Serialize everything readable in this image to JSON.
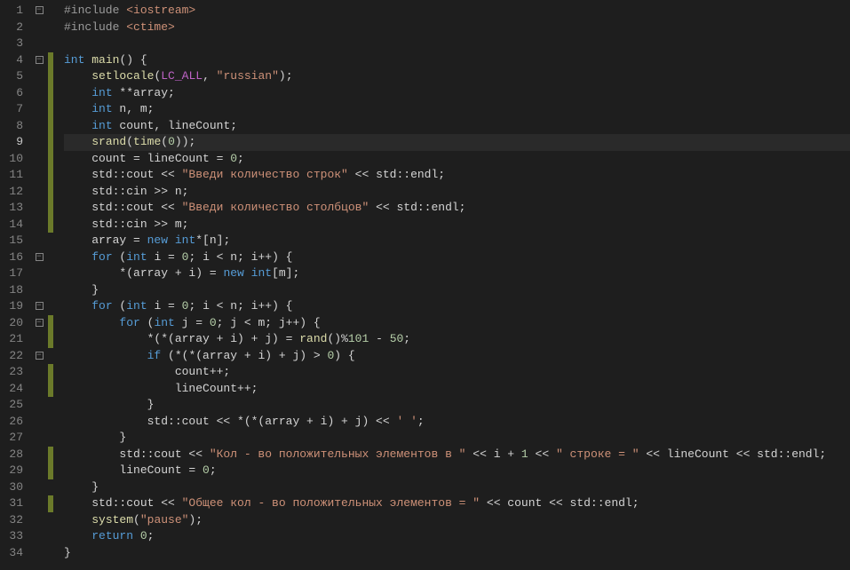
{
  "lines": [
    {
      "n": 1,
      "changed": false,
      "fold": "open",
      "html": "<span class='pre'>#include </span><span class='inc'>&lt;iostream&gt;</span>"
    },
    {
      "n": 2,
      "changed": false,
      "fold": "",
      "html": "<span class='pre'>#include </span><span class='inc'>&lt;ctime&gt;</span>"
    },
    {
      "n": 3,
      "changed": false,
      "fold": "",
      "html": ""
    },
    {
      "n": 4,
      "changed": true,
      "fold": "open",
      "html": "<span class='k'>int</span> <span class='fn'>main</span>() {"
    },
    {
      "n": 5,
      "changed": true,
      "fold": "",
      "html": "    <span class='fn'>setlocale</span>(<span class='mc'>LC_ALL</span>, <span class='s'>\"russian\"</span>);"
    },
    {
      "n": 6,
      "changed": true,
      "fold": "",
      "html": "    <span class='k'>int</span> **array;"
    },
    {
      "n": 7,
      "changed": true,
      "fold": "",
      "html": "    <span class='k'>int</span> n, m;"
    },
    {
      "n": 8,
      "changed": true,
      "fold": "",
      "html": "    <span class='k'>int</span> count, lineCount;"
    },
    {
      "n": 9,
      "changed": true,
      "fold": "",
      "current": true,
      "html": "    <span class='fn'>srand</span>(<span class='fn'>time</span>(<span class='n'>0</span>));"
    },
    {
      "n": 10,
      "changed": true,
      "fold": "",
      "html": "    count = lineCount = <span class='n'>0</span>;"
    },
    {
      "n": 11,
      "changed": true,
      "fold": "",
      "html": "    std::cout &lt;&lt; <span class='s'>\"Введи количество строк\"</span> &lt;&lt; std::endl;"
    },
    {
      "n": 12,
      "changed": true,
      "fold": "",
      "html": "    std::cin &gt;&gt; n;"
    },
    {
      "n": 13,
      "changed": true,
      "fold": "",
      "html": "    std::cout &lt;&lt; <span class='s'>\"Введи количество столбцов\"</span> &lt;&lt; std::endl;"
    },
    {
      "n": 14,
      "changed": true,
      "fold": "",
      "html": "    std::cin &gt;&gt; m;"
    },
    {
      "n": 15,
      "changed": false,
      "fold": "",
      "html": "    array = <span class='k'>new</span> <span class='k'>int</span>*[n];"
    },
    {
      "n": 16,
      "changed": false,
      "fold": "open",
      "html": "    <span class='k'>for</span> (<span class='k'>int</span> i = <span class='n'>0</span>; i &lt; n; i++) {"
    },
    {
      "n": 17,
      "changed": false,
      "fold": "",
      "html": "        *(array + i) = <span class='k'>new</span> <span class='k'>int</span>[m];"
    },
    {
      "n": 18,
      "changed": false,
      "fold": "",
      "html": "    }"
    },
    {
      "n": 19,
      "changed": false,
      "fold": "open",
      "html": "    <span class='k'>for</span> (<span class='k'>int</span> i = <span class='n'>0</span>; i &lt; n; i++) {"
    },
    {
      "n": 20,
      "changed": true,
      "fold": "open",
      "html": "        <span class='k'>for</span> (<span class='k'>int</span> j = <span class='n'>0</span>; j &lt; m; j++) {"
    },
    {
      "n": 21,
      "changed": true,
      "fold": "",
      "html": "            *(*(array + i) + j) = <span class='fn'>rand</span>()%<span class='n'>101</span> - <span class='n'>50</span>;"
    },
    {
      "n": 22,
      "changed": false,
      "fold": "open",
      "html": "            <span class='k'>if</span> (*(*(array + i) + j) &gt; <span class='n'>0</span>) {"
    },
    {
      "n": 23,
      "changed": true,
      "fold": "",
      "html": "                count++;"
    },
    {
      "n": 24,
      "changed": true,
      "fold": "",
      "html": "                lineCount++;"
    },
    {
      "n": 25,
      "changed": false,
      "fold": "",
      "html": "            }"
    },
    {
      "n": 26,
      "changed": false,
      "fold": "",
      "html": "            std::cout &lt;&lt; *(*(array + i) + j) &lt;&lt; <span class='s'>' '</span>;"
    },
    {
      "n": 27,
      "changed": false,
      "fold": "",
      "html": "        }"
    },
    {
      "n": 28,
      "changed": true,
      "fold": "",
      "html": "        std::cout &lt;&lt; <span class='s'>\"Кол - во положительных элементов в \"</span> &lt;&lt; i + <span class='n'>1</span> &lt;&lt; <span class='s'>\" строке = \"</span> &lt;&lt; lineCount &lt;&lt; std::endl;"
    },
    {
      "n": 29,
      "changed": true,
      "fold": "",
      "html": "        lineCount = <span class='n'>0</span>;"
    },
    {
      "n": 30,
      "changed": false,
      "fold": "",
      "html": "    }"
    },
    {
      "n": 31,
      "changed": true,
      "fold": "",
      "html": "    std::cout &lt;&lt; <span class='s'>\"Общее кол - во положительных элементов = \"</span> &lt;&lt; count &lt;&lt; std::endl;"
    },
    {
      "n": 32,
      "changed": false,
      "fold": "",
      "html": "    <span class='fn'>system</span>(<span class='s'>\"pause\"</span>);"
    },
    {
      "n": 33,
      "changed": false,
      "fold": "",
      "html": "    <span class='k'>return</span> <span class='n'>0</span>;"
    },
    {
      "n": 34,
      "changed": false,
      "fold": "",
      "html": "}"
    }
  ],
  "activeLine": 9
}
